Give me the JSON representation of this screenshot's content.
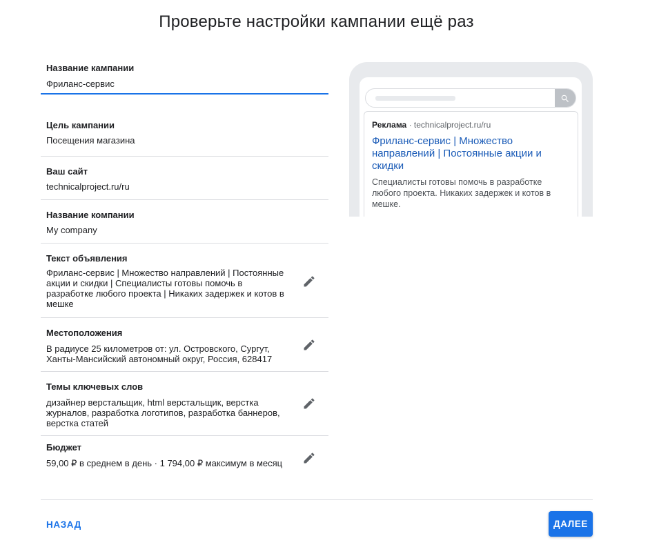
{
  "page": {
    "title": "Проверьте настройки кампании ещё раз"
  },
  "campaign_name": {
    "label": "Название кампании",
    "value": "Фриланс-сервис"
  },
  "summary": {
    "goal": {
      "label": "Цель кампании",
      "value": "Посещения магазина"
    },
    "website": {
      "label": "Ваш сайт",
      "value": "technicalproject.ru/ru"
    },
    "company": {
      "label": "Название компании",
      "value": "My company"
    },
    "ad_text": {
      "label": "Текст объявления",
      "value": "Фриланс-сервис | Множество направлений | Постоянные акции и скидки | Специалисты готовы помочь в разработке любого проекта | Никаких задержек и котов в мешке"
    },
    "locations": {
      "label": "Местоположения",
      "value": "В радиусе 25 километров от: ул. Островского, Сургут, Ханты-Мансийский автономный округ, Россия, 628417"
    },
    "keywords": {
      "label": "Темы ключевых слов",
      "value": "дизайнер верстальщик, html верстальщик, верстка журналов, разработка логотипов, разработка баннеров, верстка статей"
    },
    "budget": {
      "label": "Бюджет",
      "value": "59,00 ₽ в среднем в день · 1 794,00 ₽ максимум в месяц"
    }
  },
  "preview": {
    "ad_label": "Реклама",
    "separator": " · ",
    "display_url": "technicalproject.ru/ru",
    "headline": "Фриланс-сервис | Множество направлений | Постоянные акции и скидки",
    "description": "Специалисты готовы помочь в разработке любого проекта. Никаких задержек и котов в мешке."
  },
  "icons": {
    "edit": "pencil-icon",
    "search": "search-icon"
  },
  "footer": {
    "back_label": "НАЗАД",
    "next_label": "ДАЛЕЕ"
  },
  "colors": {
    "primary": "#1a73e8",
    "ad_headline": "#1a5bb7",
    "divider": "#dadce0",
    "preview_frame": "#e8eaed"
  }
}
